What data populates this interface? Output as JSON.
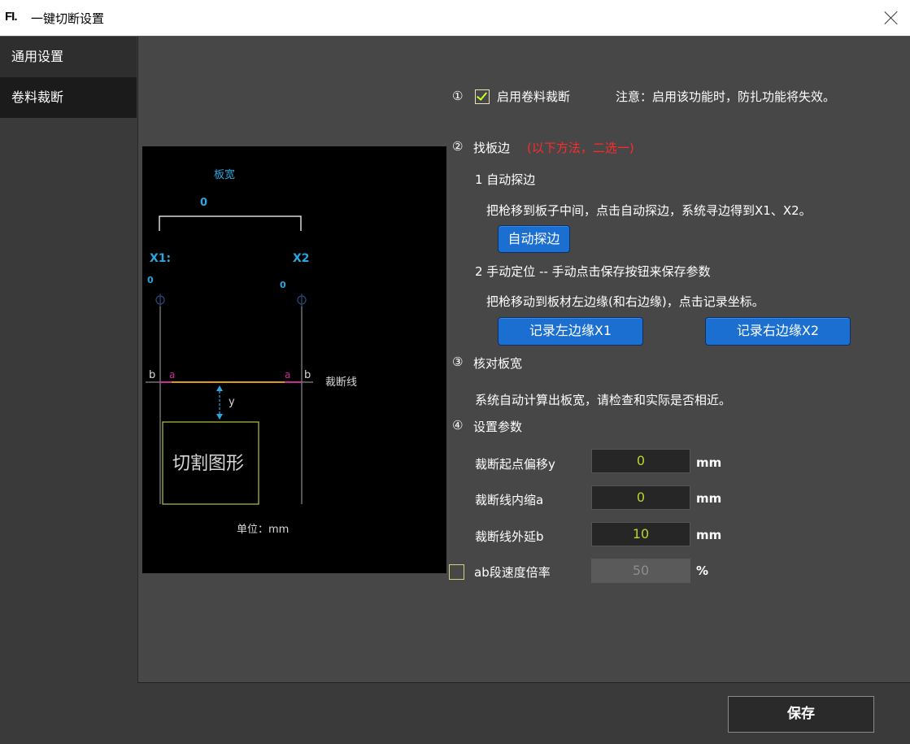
{
  "window": {
    "logo": "FI.",
    "title": "一键切断设置"
  },
  "sidebar": {
    "items": [
      {
        "label": "通用设置"
      },
      {
        "label": "卷料裁断"
      }
    ]
  },
  "diagram": {
    "width_label": "板宽",
    "width_value": "0",
    "x1_label": "X1:",
    "x1_value": "0",
    "x2_label": "X2",
    "x2_value": "0",
    "b_left": "b",
    "a_left": "a",
    "a_right": "a",
    "b_right": "b",
    "cut_line_label": "裁断线",
    "y_label": "y",
    "shape_label": "切割图形",
    "unit_label": "单位：mm"
  },
  "settings": {
    "step1_num": "①",
    "enable_label": "启用卷料裁断",
    "enable_checked": true,
    "enable_note": "注意：启用该功能时，防扎功能将失效。",
    "step2_num": "②",
    "step2_title": "找板边",
    "step2_hint": "(以下方法，二选一)",
    "method1_title": "1 自动探边",
    "method1_desc": "把枪移到板子中间，点击自动探边，系统寻边得到X1、X2。",
    "auto_detect_button": "自动探边",
    "method2_title": "2 手动定位 -- 手动点击保存按钮来保存参数",
    "method2_desc": "把枪移动到板材左边缘(和右边缘)，点击记录坐标。",
    "record_left_button": "记录左边缘X1",
    "record_right_button": "记录右边缘X2",
    "step3_num": "③",
    "step3_title": "核对板宽",
    "step3_desc": "系统自动计算出板宽，请检查和实际是否相近。",
    "step4_num": "④",
    "step4_title": "设置参数",
    "param_y_label": "裁断起点偏移y",
    "param_y_value": "0",
    "param_y_unit": "mm",
    "param_a_label": "裁断线内缩a",
    "param_a_value": "0",
    "param_a_unit": "mm",
    "param_b_label": "裁断线外延b",
    "param_b_value": "10",
    "param_b_unit": "mm",
    "speed_label": "ab段速度倍率",
    "speed_checked": false,
    "speed_value": "50",
    "speed_unit": "%"
  },
  "footer": {
    "save_button": "保存"
  },
  "colors": {
    "accent_blue": "#1a6fd1",
    "diagram_cyan": "#2aa7e0",
    "value_green": "#b7d72c",
    "warning_red": "#ff2a2a"
  }
}
